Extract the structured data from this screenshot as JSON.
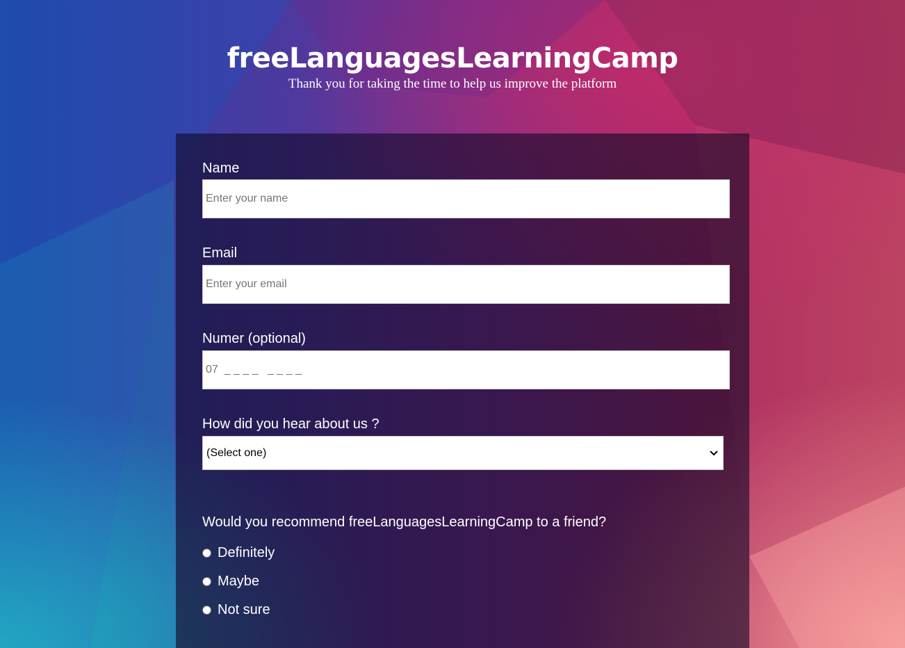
{
  "header": {
    "title": "freeLanguagesLearningCamp",
    "subtitle": "Thank you for taking the time to help us improve the platform"
  },
  "form": {
    "name": {
      "label": "Name",
      "placeholder": "Enter your name",
      "value": ""
    },
    "email": {
      "label": "Email",
      "placeholder": "Enter your email",
      "value": ""
    },
    "number": {
      "label": "Numer (optional)",
      "placeholder": "07  _ _ _ _   _ _ _ _",
      "value": ""
    },
    "source": {
      "label": "How did you hear about us ?",
      "selected": "(Select one)"
    },
    "recommend": {
      "question": "Would you recommend freeLanguagesLearningCamp to a friend?",
      "options": [
        {
          "label": "Definitely"
        },
        {
          "label": "Maybe"
        },
        {
          "label": "Not sure"
        }
      ]
    }
  },
  "colors": {
    "panel": "#120a28",
    "background_left": "#1f4aa8",
    "background_right": "#b9405c",
    "accent_teal": "#2ab3c0",
    "accent_pink": "#f59a98"
  },
  "icons": {
    "select_chevron": "chevron-down-icon"
  }
}
